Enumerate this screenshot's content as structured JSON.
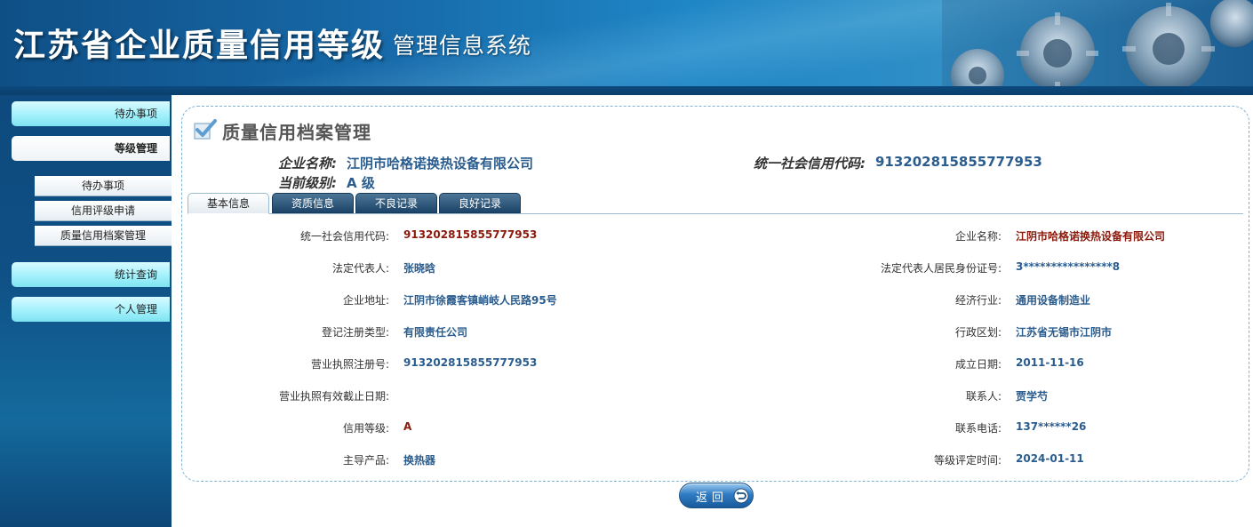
{
  "header": {
    "title": "江苏省企业质量信用等级",
    "subtitle": "管理信息系统"
  },
  "sidebar": {
    "items": [
      {
        "label": "待办事项"
      },
      {
        "label": "等级管理"
      },
      {
        "label": "统计查询"
      },
      {
        "label": "个人管理"
      }
    ],
    "subitems": [
      {
        "label": "待办事项"
      },
      {
        "label": "信用评级申请"
      },
      {
        "label": "质量信用档案管理"
      }
    ]
  },
  "page": {
    "title": "质量信用档案管理"
  },
  "summary": {
    "company_label": "企业名称:",
    "company_value": "江阴市哈格诺换热设备有限公司",
    "credit_code_label": "统一社会信用代码:",
    "credit_code_value": "913202815855777953",
    "level_label": "当前级别:",
    "level_value": "A 级"
  },
  "tabs": [
    {
      "label": "基本信息"
    },
    {
      "label": "资质信息"
    },
    {
      "label": "不良记录"
    },
    {
      "label": "良好记录"
    }
  ],
  "fields_left": [
    {
      "label": "统一社会信用代码:",
      "value": "913202815855777953"
    },
    {
      "label": "法定代表人:",
      "value": "张晓晗"
    },
    {
      "label": "企业地址:",
      "value": "江阴市徐霞客镇峭岐人民路95号"
    },
    {
      "label": "登记注册类型:",
      "value": "有限责任公司"
    },
    {
      "label": "营业执照注册号:",
      "value": "913202815855777953"
    },
    {
      "label": "营业执照有效截止日期:",
      "value": ""
    },
    {
      "label": "信用等级:",
      "value": "A"
    },
    {
      "label": "主导产品:",
      "value": "换热器"
    }
  ],
  "fields_right": [
    {
      "label": "企业名称:",
      "value": "江阴市哈格诺换热设备有限公司"
    },
    {
      "label": "法定代表人居民身份证号:",
      "value": "3****************8"
    },
    {
      "label": "经济行业:",
      "value": "通用设备制造业"
    },
    {
      "label": "行政区划:",
      "value": "江苏省无锡市江阴市"
    },
    {
      "label": "成立日期:",
      "value": "2011-11-16"
    },
    {
      "label": "联系人:",
      "value": "贾学芍"
    },
    {
      "label": "联系电话:",
      "value": "137******26"
    },
    {
      "label": "等级评定时间:",
      "value": "2024-01-11"
    }
  ],
  "back_button": {
    "label": "返回"
  },
  "colors": {
    "header_blue": "#1769a8",
    "sidebar_blue": "#0f4f84",
    "nav_cyan": "#9ff0fb",
    "value_blue": "#2a5c8e",
    "value_red": "#8b1a0c"
  },
  "icons": [
    "check-icon",
    "gear-art",
    "return-icon"
  ]
}
